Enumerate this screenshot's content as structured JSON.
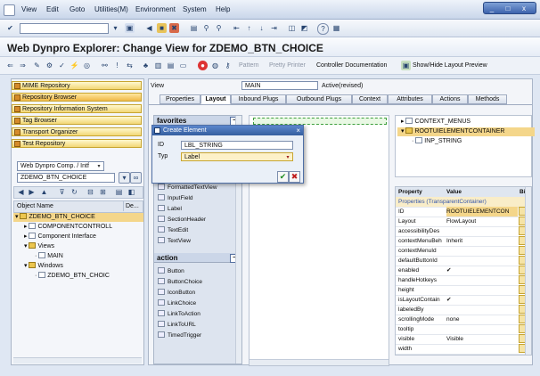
{
  "menubar": {
    "items": [
      "View",
      "Edit",
      "Goto",
      "Utilities(M)",
      "Environment",
      "System",
      "Help"
    ]
  },
  "window_controls": [
    "_",
    "□",
    "x"
  ],
  "title": "Web Dynpro Explorer: Change View for ZDEMO_BTN_CHOICE",
  "app_toolbar": {
    "pattern": "Pattern",
    "pretty_printer": "Pretty Printer",
    "controller_doc": "Controller Documentation",
    "show_hide": "Show/Hide Layout Preview"
  },
  "nav": [
    "MIME Repository",
    "Repository Browser",
    "Repository Information System",
    "Tag Browser",
    "Transport Organizer",
    "Test Repository"
  ],
  "object_type": "Web Dynpro Comp. / Intf",
  "object_name": "ZDEMO_BTN_CHOICE",
  "object_list": {
    "col1": "Object Name",
    "col2": "De...",
    "items": [
      "ZDEMO_BTN_CHOICE",
      "COMPONENTCONTROLL",
      "Component Interface",
      "Views",
      "MAIN",
      "Windows",
      "ZDEMO_BTN_CHOIC"
    ]
  },
  "view_row": {
    "label": "View",
    "value": "MAIN",
    "status": "Active(revised)"
  },
  "tabs": [
    "Properties",
    "Layout",
    "Inbound Plugs",
    "Outbound Plugs",
    "Context",
    "Attributes",
    "Actions",
    "Methods"
  ],
  "palette": {
    "favorites_label": "favorites",
    "text_items": [
      "FormattedTextView",
      "InputField",
      "Label",
      "SectionHeader",
      "TextEdit",
      "TextView"
    ],
    "action_label": "action",
    "action_items": [
      "Button",
      "ButtonChoice",
      "IconButton",
      "LinkChoice",
      "LinkToAction",
      "LinkToURL",
      "TimedTrigger"
    ]
  },
  "ui_tree": [
    "CONTEXT_MENUS",
    "ROOTUIELEMENTCONTAINER",
    "INP_STRING"
  ],
  "properties": {
    "header_property": "Property",
    "header_value": "Value",
    "header_binding": "Bi",
    "section": "Properties (TransparentContainer)",
    "rows": [
      {
        "k": "ID",
        "v": "ROOTUIELEMENTCON"
      },
      {
        "k": "Layout",
        "v": "FlowLayout"
      },
      {
        "k": "accessibilityDes",
        "v": ""
      },
      {
        "k": "contextMenuBeh",
        "v": "Inherit"
      },
      {
        "k": "contextMenuId",
        "v": ""
      },
      {
        "k": "defaultButtonId",
        "v": ""
      },
      {
        "k": "enabled",
        "v": "✔"
      },
      {
        "k": "handleHotkeys",
        "v": ""
      },
      {
        "k": "height",
        "v": ""
      },
      {
        "k": "isLayoutContain",
        "v": "✔"
      },
      {
        "k": "labeledBy",
        "v": ""
      },
      {
        "k": "scrollingMode",
        "v": "none"
      },
      {
        "k": "tooltip",
        "v": ""
      },
      {
        "k": "visible",
        "v": "Visible"
      },
      {
        "k": "width",
        "v": ""
      }
    ]
  },
  "dialog": {
    "title": "Create Element",
    "id_label": "ID",
    "id_value": "LBL_STRING",
    "type_label": "Typ",
    "type_value": "Label"
  },
  "colors": {
    "accent": "#f2d775",
    "title_bar": "#355f9f",
    "dropzone": "#3e9f3e"
  }
}
